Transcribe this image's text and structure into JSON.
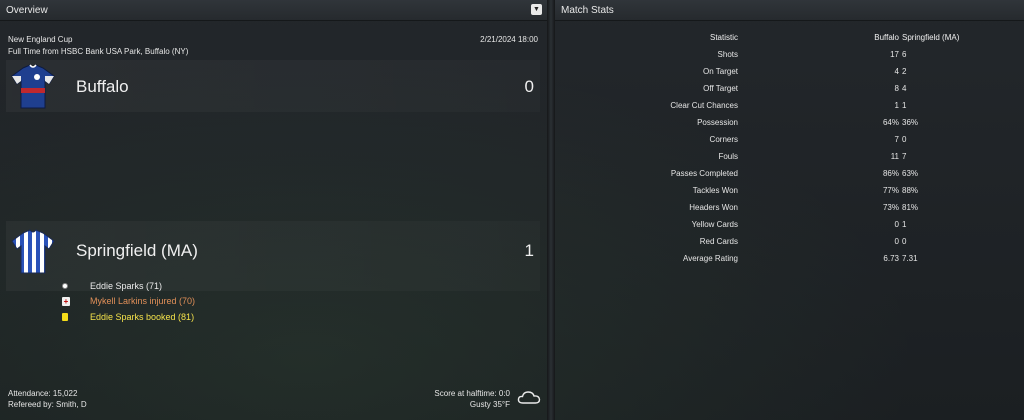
{
  "overview": {
    "title": "Overview",
    "competition": "New England Cup",
    "datetime": "2/21/2024 18:00",
    "venue": "Full Time from HSBC Bank USA Park, Buffalo (NY)",
    "home": {
      "name": "Buffalo",
      "score": "0",
      "kit_color": "#1f3f8f"
    },
    "away": {
      "name": "Springfield (MA)",
      "score": "1",
      "kit_color": "#2a52b8"
    },
    "events": [
      {
        "icon": "ball-icon",
        "text": "Eddie Sparks (71)",
        "color": "#ececec"
      },
      {
        "icon": "injury-icon",
        "text": "Mykell Larkins injured (70)",
        "color": "#e08f58"
      },
      {
        "icon": "yellow-card-icon",
        "text": "Eddie Sparks booked (81)",
        "color": "#f4e24a"
      }
    ],
    "attendance": "Attendance: 15,022",
    "referee": "Refereed by: Smith, D",
    "halftime": "Score at halftime: 0:0",
    "weather": "Gusty 35°F",
    "weather_icon": "cloud-icon"
  },
  "match_stats": {
    "title": "Match Stats",
    "header": {
      "stat": "Statistic",
      "home": "Buffalo",
      "away": "Springfield (MA)"
    },
    "rows": [
      {
        "name": "Shots",
        "home": "17",
        "away": "6"
      },
      {
        "name": "On Target",
        "home": "4",
        "away": "2"
      },
      {
        "name": "Off Target",
        "home": "8",
        "away": "4"
      },
      {
        "name": "Clear Cut Chances",
        "home": "1",
        "away": "1"
      },
      {
        "name": "Possession",
        "home": "64%",
        "away": "36%"
      },
      {
        "name": "Corners",
        "home": "7",
        "away": "0"
      },
      {
        "name": "Fouls",
        "home": "11",
        "away": "7"
      },
      {
        "name": "Passes Completed",
        "home": "86%",
        "away": "63%"
      },
      {
        "name": "Tackles Won",
        "home": "77%",
        "away": "88%"
      },
      {
        "name": "Headers Won",
        "home": "73%",
        "away": "81%"
      },
      {
        "name": "Yellow Cards",
        "home": "0",
        "away": "1"
      },
      {
        "name": "Red Cards",
        "home": "0",
        "away": "0"
      },
      {
        "name": "Average Rating",
        "home": "6.73",
        "away": "7.31"
      }
    ]
  }
}
